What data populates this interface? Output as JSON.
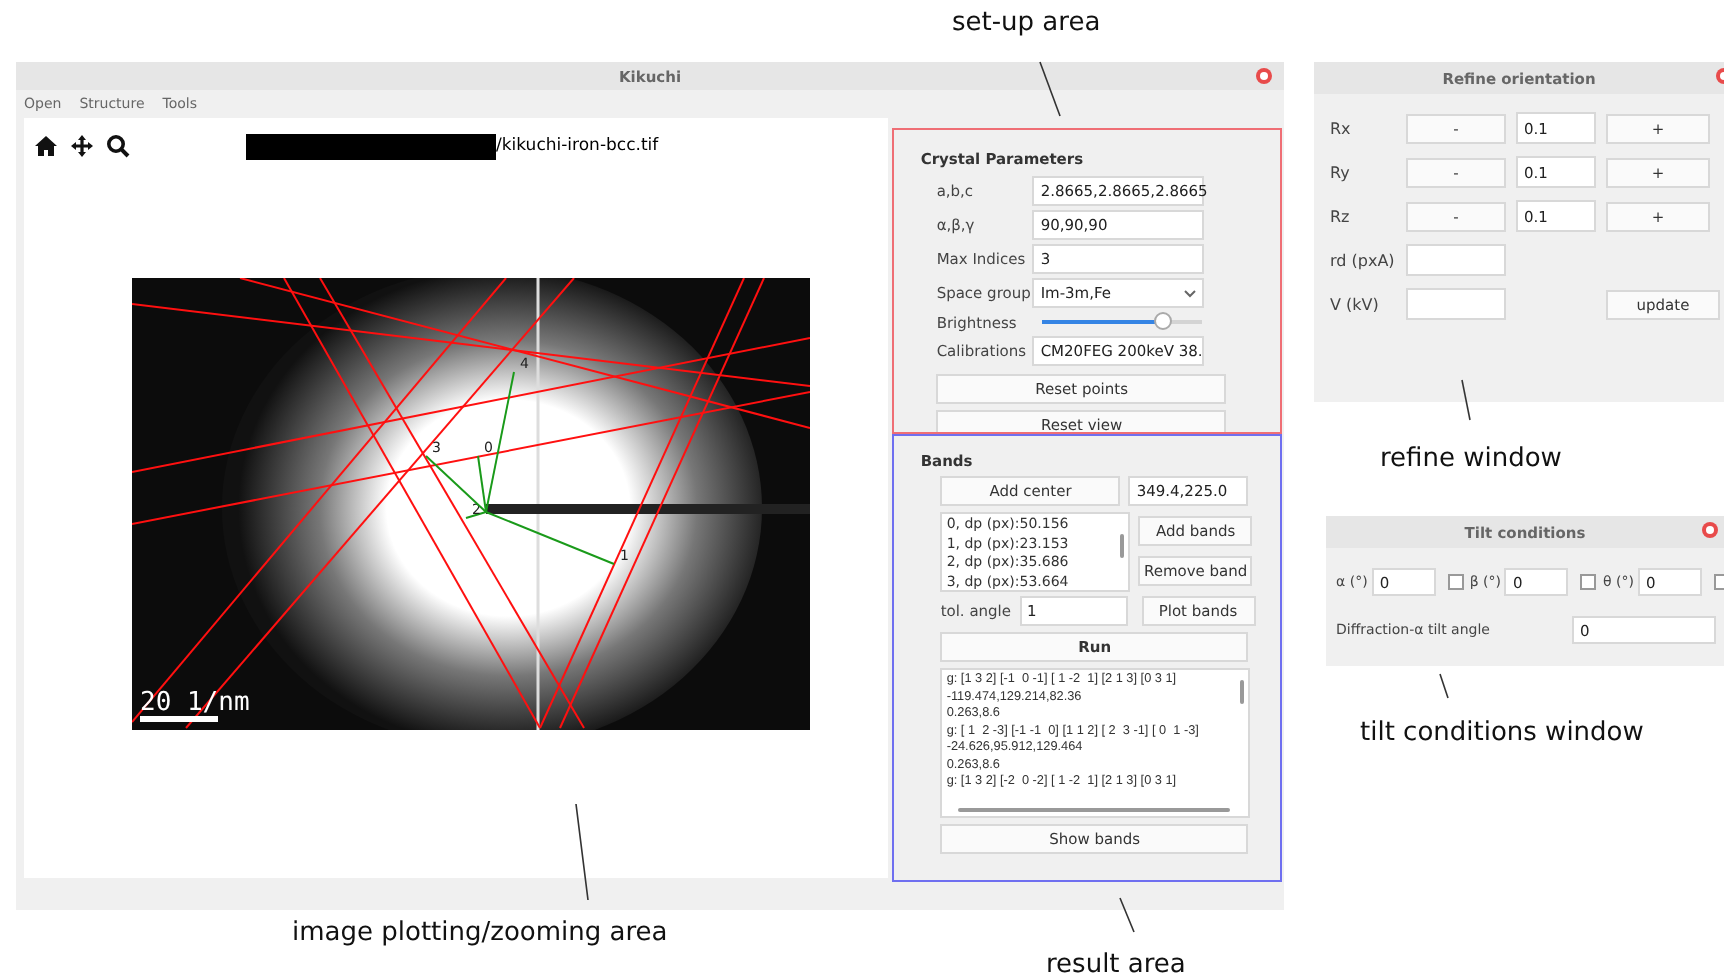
{
  "main_window": {
    "title": "Kikuchi",
    "menu": [
      "Open",
      "Structure",
      "Tools"
    ],
    "file_path": "/kikuchi-iron-bcc.tif",
    "pattern": {
      "band_labels": [
        {
          "label": "0"
        },
        {
          "label": "1"
        },
        {
          "label": "2"
        },
        {
          "label": "3"
        },
        {
          "label": "4"
        }
      ],
      "scale_bar": "20 1/nm"
    },
    "setup": {
      "heading": "Crystal Parameters",
      "fields": [
        {
          "kind": "input",
          "label": "a,b,c",
          "value": "2.8665,2.8665,2.8665"
        },
        {
          "kind": "input",
          "label": "α,β,γ",
          "value": "90,90,90"
        },
        {
          "kind": "input",
          "label": "Max Indices",
          "value": "3"
        },
        {
          "kind": "select",
          "label": "Space group",
          "value": "Im-3m,Fe"
        },
        {
          "kind": "slider",
          "label": "Brightness",
          "level": 0.75
        },
        {
          "kind": "select",
          "label": "Calibrations",
          "value": "CM20FEG 200keV 38."
        }
      ],
      "buttons": [
        "Reset points",
        "Reset view"
      ]
    },
    "bands": {
      "heading": "Bands",
      "add_center": "Add center",
      "center_value": "349.4,225.0",
      "band_list": [
        "0, dp (px):50.156",
        "1, dp (px):23.153",
        "2, dp (px):35.686",
        "3, dp (px):53.664"
      ],
      "buttons": [
        "Add bands",
        "Remove band"
      ],
      "tol_label": "tol. angle",
      "tol_value": "1",
      "plot_button": "Plot bands",
      "run_button": "Run",
      "results": [
        "g: [1 3 2] [-1  0 -1] [ 1 -2  1] [2 1 3] [0 3 1]",
        "-119.474,129.214,82.36",
        "0.263,8.6",
        "g: [ 1  2 -3] [-1 -1  0] [1 1 2] [ 2  3 -1] [ 0  1 -3]",
        "-24.626,95.912,129.464",
        "0.263,8.6",
        "g: [1 3 2] [-2  0 -2] [ 1 -2  1] [2 1 3] [0 3 1]"
      ],
      "show_button": "Show bands"
    }
  },
  "refine_window": {
    "title": "Refine orientation",
    "rows": [
      {
        "label": "Rx",
        "minus": "-",
        "value": "0.1",
        "plus": "+"
      },
      {
        "label": "Ry",
        "minus": "-",
        "value": "0.1",
        "plus": "+"
      },
      {
        "label": "Rz",
        "minus": "-",
        "value": "0.1",
        "plus": "+"
      }
    ],
    "rd_label": "rd (pxA)",
    "voltage_label": "V (kV)",
    "update_button": "update"
  },
  "tilt_window": {
    "title": "Tilt conditions",
    "angles": [
      {
        "label": "α (°)",
        "value": "0",
        "checked": false
      },
      {
        "label": "β (°)",
        "value": "0",
        "checked": false
      },
      {
        "label": "θ (°)",
        "value": "0",
        "checked": false
      }
    ],
    "diffraction_label": "Diffraction-α tilt angle",
    "diffraction_value": "0"
  },
  "annotations": [
    {
      "text": "set-up area"
    },
    {
      "text": "refine window"
    },
    {
      "text": "tilt conditions window"
    },
    {
      "text": "image plotting/zooming area"
    },
    {
      "text": "result area"
    }
  ]
}
